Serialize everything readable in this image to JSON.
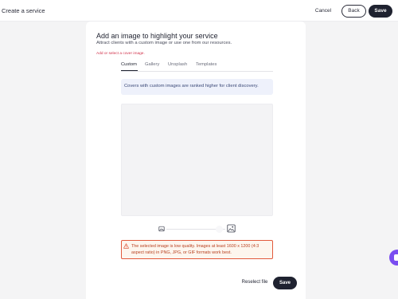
{
  "header": {
    "title": "Create a service",
    "cancel_label": "Cancel",
    "back_label": "Back",
    "save_label": "Save"
  },
  "panel": {
    "heading": "Add an image to highlight your service",
    "subheading": "Attract clients with a custom image or use one from our resources.",
    "error": "Add or select a cover image.",
    "tabs": [
      {
        "label": "Custom",
        "active": true
      },
      {
        "label": "Gallery",
        "active": false
      },
      {
        "label": "Unsplash",
        "active": false
      },
      {
        "label": "Templates",
        "active": false
      }
    ],
    "info_banner": "Covers with custom images are ranked higher for client discovery.",
    "warning": "The selected image is low quality. Images at least 1600 x 1200 (4:3 aspect ratio) in PNG, JPG, or GIF formats work best.",
    "reselect_label": "Reselect file",
    "save_label": "Save"
  },
  "colors": {
    "primary": "#1f2230",
    "error": "#d0314a",
    "warning_border": "#e25a3c",
    "info_bg": "#eef1fb",
    "chat_accent": "#7a4df0"
  },
  "icons": {
    "zoom_out": "image-small-icon",
    "zoom_in": "image-large-icon",
    "warning": "warning-triangle-icon",
    "chat": "chat-icon"
  }
}
